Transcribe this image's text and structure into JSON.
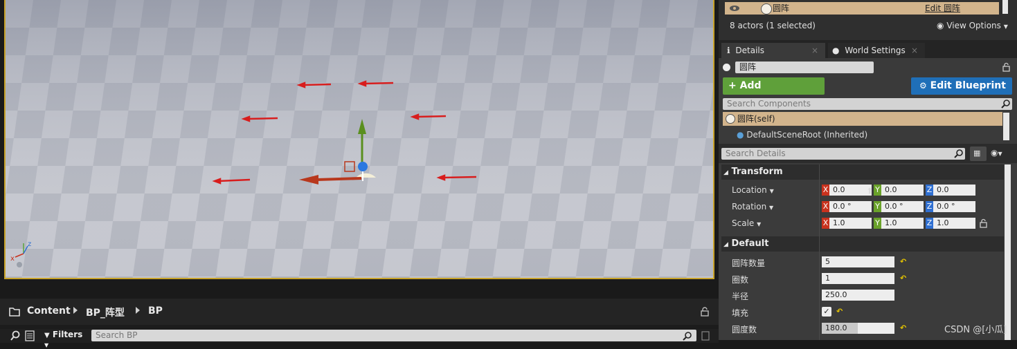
{
  "outliner": {
    "actor_name": "圆阵",
    "edit_link": "Edit 圆阵",
    "count_text": "8 actors (1 selected)",
    "view_options": "View Options"
  },
  "tabs": [
    {
      "label": "Details"
    },
    {
      "label": "World Settings"
    }
  ],
  "details": {
    "actor_name_value": "圆阵",
    "add_component": "Add Component",
    "edit_blueprint": "Edit Blueprint",
    "search_components_placeholder": "Search Components",
    "components": [
      {
        "label": "圆阵(self)"
      },
      {
        "label": "DefaultSceneRoot (Inherited)"
      }
    ],
    "search_details_placeholder": "Search Details"
  },
  "transform": {
    "section": "Transform",
    "location": {
      "label": "Location",
      "x": "0.0",
      "y": "0.0",
      "z": "0.0"
    },
    "rotation": {
      "label": "Rotation",
      "x": "0.0 °",
      "y": "0.0 °",
      "z": "0.0 °"
    },
    "scale": {
      "label": "Scale",
      "x": "1.0",
      "y": "1.0",
      "z": "1.0"
    }
  },
  "default_section": {
    "section": "Default",
    "props": [
      {
        "label": "圆阵数量",
        "value": "5"
      },
      {
        "label": "圈数",
        "value": "1"
      },
      {
        "label": "半径",
        "value": "250.0"
      },
      {
        "label": "填充",
        "checked": true
      },
      {
        "label": "圆度数",
        "value": "180.0"
      }
    ]
  },
  "content_browser": {
    "crumbs": [
      "Content",
      "BP_阵型",
      "BP"
    ],
    "filters": "Filters",
    "search_placeholder": "Search BP"
  },
  "viewport_axis": {
    "x": "x",
    "z": "z"
  },
  "watermark": "CSDN @[小瓜]"
}
